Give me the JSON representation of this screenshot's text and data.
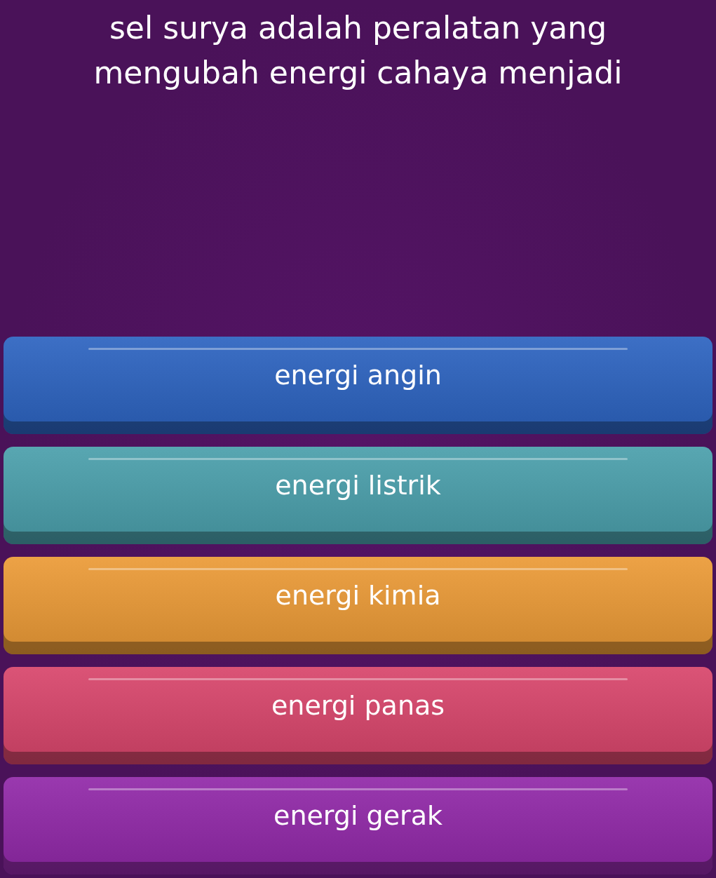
{
  "question": "sel surya adalah peralatan yang mengubah energi cahaya menjadi",
  "options": [
    {
      "label": "energi angin",
      "color": "#2c63c0"
    },
    {
      "label": "energi listrik",
      "color": "#4a9fab"
    },
    {
      "label": "energi kimia",
      "color": "#eb9a36"
    },
    {
      "label": "energi panas",
      "color": "#d8456b"
    },
    {
      "label": "energi gerak",
      "color": "#9128a8"
    }
  ]
}
